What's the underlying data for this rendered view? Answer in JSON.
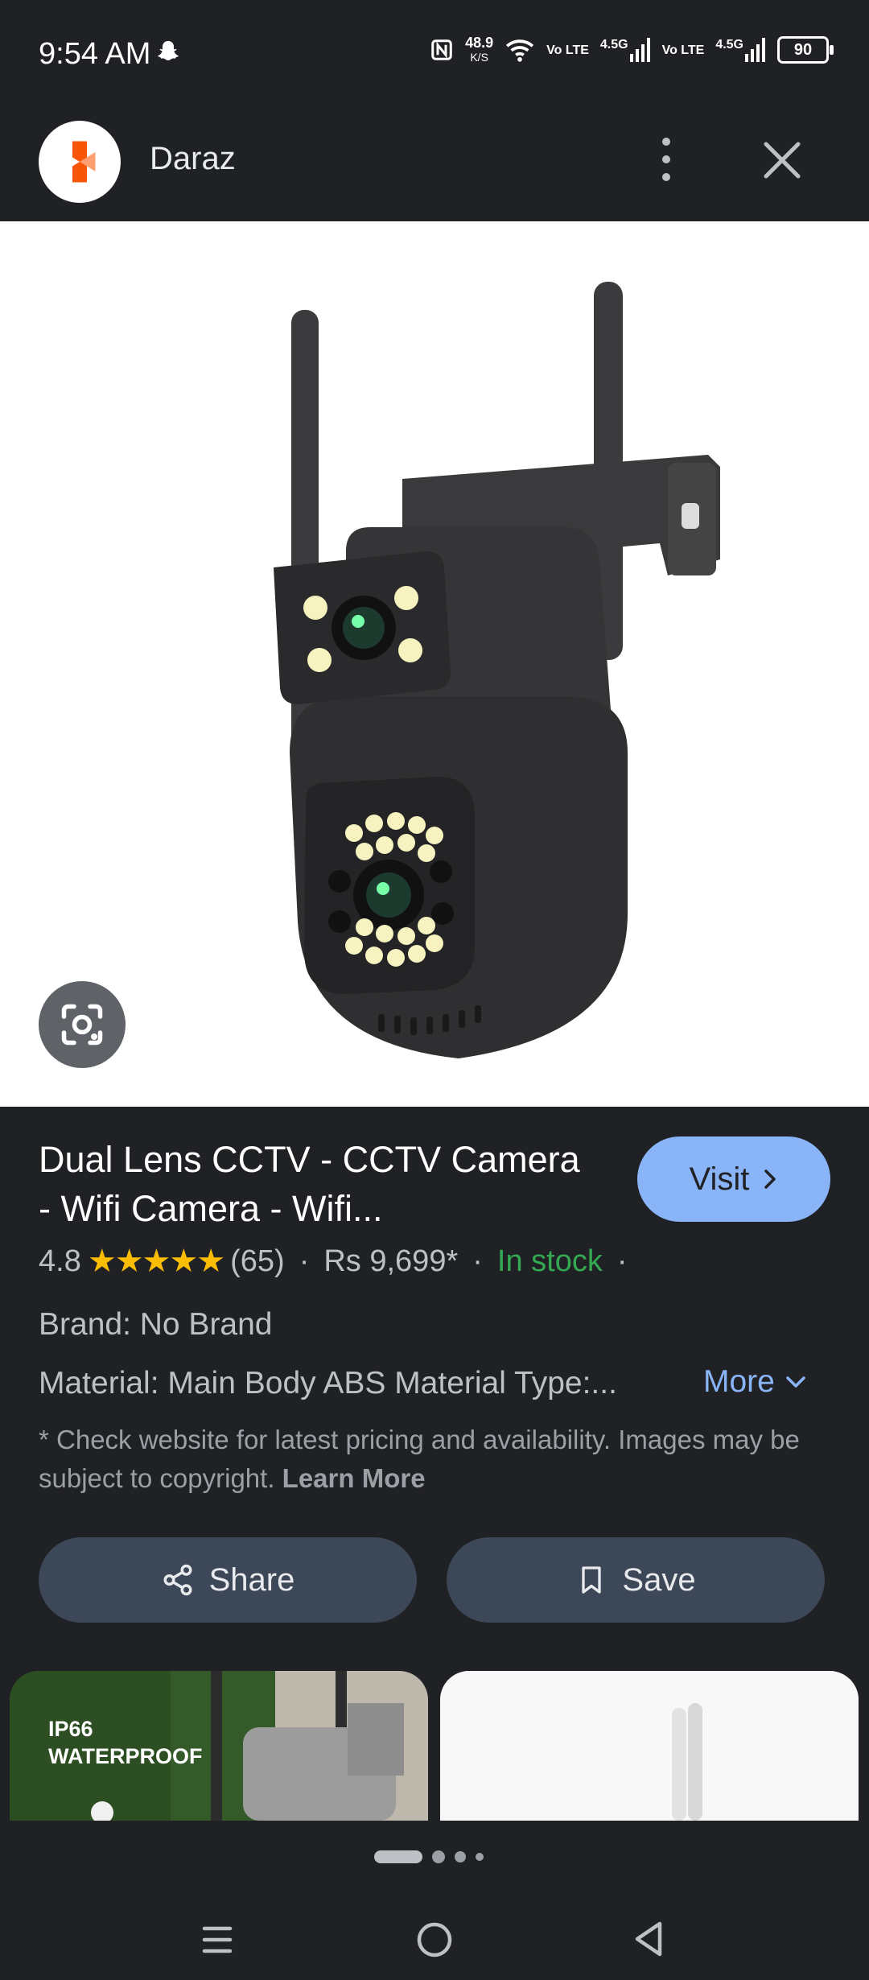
{
  "status_bar": {
    "time": "9:54 AM",
    "net_speed": "48.9",
    "net_unit": "K/S",
    "volte1": "Vo LTE",
    "signal1": "4.5G",
    "volte2": "Vo LTE",
    "signal2": "4.5G",
    "battery": "90"
  },
  "app_bar": {
    "title": "Daraz"
  },
  "product": {
    "title": "Dual Lens CCTV - CCTV Camera - Wifi Camera - Wifi...",
    "visit_label": "Visit",
    "rating": "4.8",
    "stars": "★★★★★",
    "review_count": "(65)",
    "price": "Rs 9,699*",
    "availability": "In stock",
    "brand": "Brand: No Brand",
    "material": "Material: Main Body ABS Material Type:...",
    "more_label": "More",
    "disclaimer": "* Check website for latest pricing and availability. Images may be subject to copyright.",
    "learn_more": "Learn More"
  },
  "actions": {
    "share_label": "Share",
    "save_label": "Save"
  },
  "thumbnails": {
    "first_text_line1": "IP66",
    "first_text_line2": "WATERPROOF"
  },
  "colors": {
    "accent": "#8ab4f8",
    "in_stock": "#34a853",
    "star": "#fbbc04",
    "background": "#202124"
  }
}
